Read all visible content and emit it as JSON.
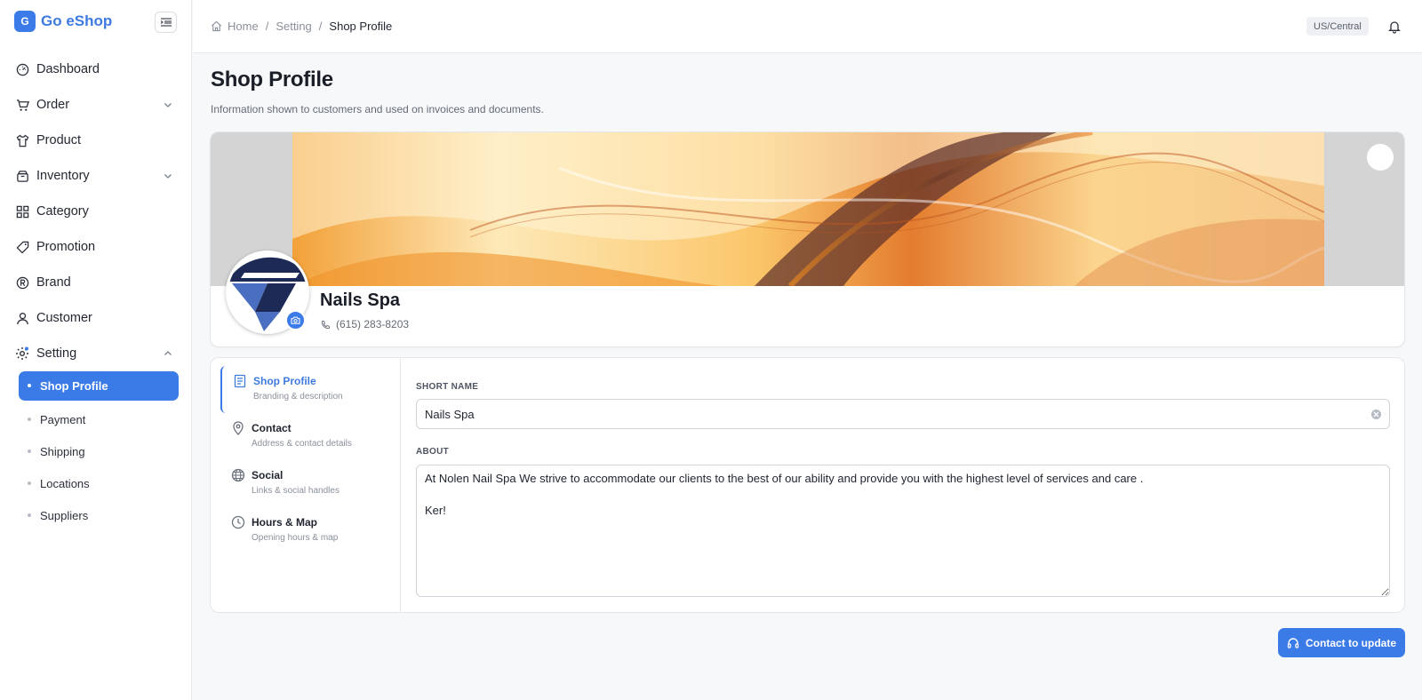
{
  "app": {
    "logo_letter": "G",
    "name": "Go eShop"
  },
  "sidebar": {
    "items": [
      {
        "label": "Dashboard",
        "icon": "gauge-icon"
      },
      {
        "label": "Order",
        "icon": "cart-icon",
        "expandable": true
      },
      {
        "label": "Product",
        "icon": "shirt-icon"
      },
      {
        "label": "Inventory",
        "icon": "box-icon",
        "expandable": true
      },
      {
        "label": "Category",
        "icon": "grid-icon"
      },
      {
        "label": "Promotion",
        "icon": "tag-icon"
      },
      {
        "label": "Brand",
        "icon": "registered-icon"
      },
      {
        "label": "Customer",
        "icon": "user-icon"
      },
      {
        "label": "Setting",
        "icon": "gear-icon",
        "expanded": true
      }
    ],
    "setting_sub": [
      {
        "label": "Shop Profile",
        "active": true
      },
      {
        "label": "Payment"
      },
      {
        "label": "Shipping"
      },
      {
        "label": "Locations"
      },
      {
        "label": "Suppliers"
      }
    ]
  },
  "header": {
    "breadcrumb": [
      "Home",
      "Setting",
      "Shop Profile"
    ],
    "timezone": "US/Central"
  },
  "page": {
    "title": "Shop Profile",
    "subtitle": "Information shown to customers and used on invoices and documents."
  },
  "profile": {
    "name": "Nails Spa",
    "phone": "(615) 283-8203"
  },
  "tabs": [
    {
      "title": "Shop Profile",
      "subtitle": "Branding & description",
      "icon": "document-icon",
      "active": true
    },
    {
      "title": "Contact",
      "subtitle": "Address & contact details",
      "icon": "map-pin-icon"
    },
    {
      "title": "Social",
      "subtitle": "Links & social handles",
      "icon": "globe-icon"
    },
    {
      "title": "Hours & Map",
      "subtitle": "Opening hours & map",
      "icon": "clock-icon"
    }
  ],
  "form": {
    "short_name_label": "SHORT NAME",
    "short_name_value": "Nails Spa",
    "about_label": "ABOUT",
    "about_value": "At Nolen Nail Spa We strive to accommodate our clients to the best of our ability and provide you with the highest level of services and care .\n\nKer!"
  },
  "actions": {
    "contact_label": "Contact to update"
  },
  "colors": {
    "accent": "#3b7be8",
    "brand_text": "#3e7ae0"
  }
}
